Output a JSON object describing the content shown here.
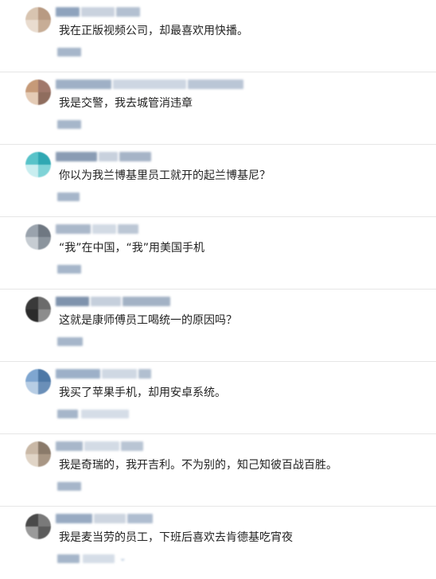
{
  "comments": [
    {
      "text": "我在正版视频公司，却最喜欢用快播。",
      "avatar_colors": [
        "#d8c4b0",
        "#b89a82",
        "#e9dccf",
        "#c7ad96"
      ],
      "name_colors": [
        "#8fa3bd",
        "#c9d2de",
        "#b3c0d1"
      ]
    },
    {
      "text": "我是交警，我去城管消违章",
      "avatar_colors": [
        "#c69a78",
        "#a0786b",
        "#e4cbb5",
        "#8f6d5e"
      ],
      "name_colors": [
        "#9fb0c6",
        "#cdd6e2",
        "#bac6d6"
      ]
    },
    {
      "text": "你以为我兰博基里员工就开的起兰博基尼？",
      "avatar_colors": [
        "#58c3c9",
        "#2fa8b3",
        "#c9eef0",
        "#7fd3d7"
      ],
      "name_colors": [
        "#8a9cb4",
        "#c8d1dd",
        "#a6b4c7"
      ]
    },
    {
      "text": "“我”在中国，“我”用美国手机",
      "avatar_colors": [
        "#9aa3ad",
        "#6f7882",
        "#c6ccd2",
        "#8b949d"
      ],
      "name_colors": [
        "#aab8ca",
        "#d2dae4",
        "#bcc7d5"
      ]
    },
    {
      "text": "这就是康师傅员工喝统一的原因吗？",
      "avatar_colors": [
        "#3a3a3a",
        "#6b6b6b",
        "#2b2b2b",
        "#8c8c8c"
      ],
      "name_colors": [
        "#7f93ad",
        "#c5cfdc",
        "#a3b2c5"
      ]
    },
    {
      "text": "我买了苹果手机，却用安卓系统。",
      "avatar_colors": [
        "#7fa6d0",
        "#4d78a6",
        "#b7cde4",
        "#6a8fb8"
      ],
      "name_colors": [
        "#9db0c8",
        "#cfd8e3",
        "#b1bfd0"
      ]
    },
    {
      "text": "我是奇瑞的，我开吉利。不为别的，知己知彼百战百胜。",
      "avatar_colors": [
        "#c9b8a6",
        "#8a7a6a",
        "#e0d4c6",
        "#a89684"
      ],
      "name_colors": [
        "#a8b7ca",
        "#d3dbe5",
        "#b9c5d4"
      ]
    },
    {
      "text": "我是麦当劳的员工，下班后喜欢去肯德基吃宵夜",
      "avatar_colors": [
        "#4a4a4a",
        "#7a7a7a",
        "#9a9a9a",
        "#5c5c5c"
      ],
      "name_colors": [
        "#98aac2",
        "#cdd5e0",
        "#afbdd0"
      ]
    }
  ]
}
